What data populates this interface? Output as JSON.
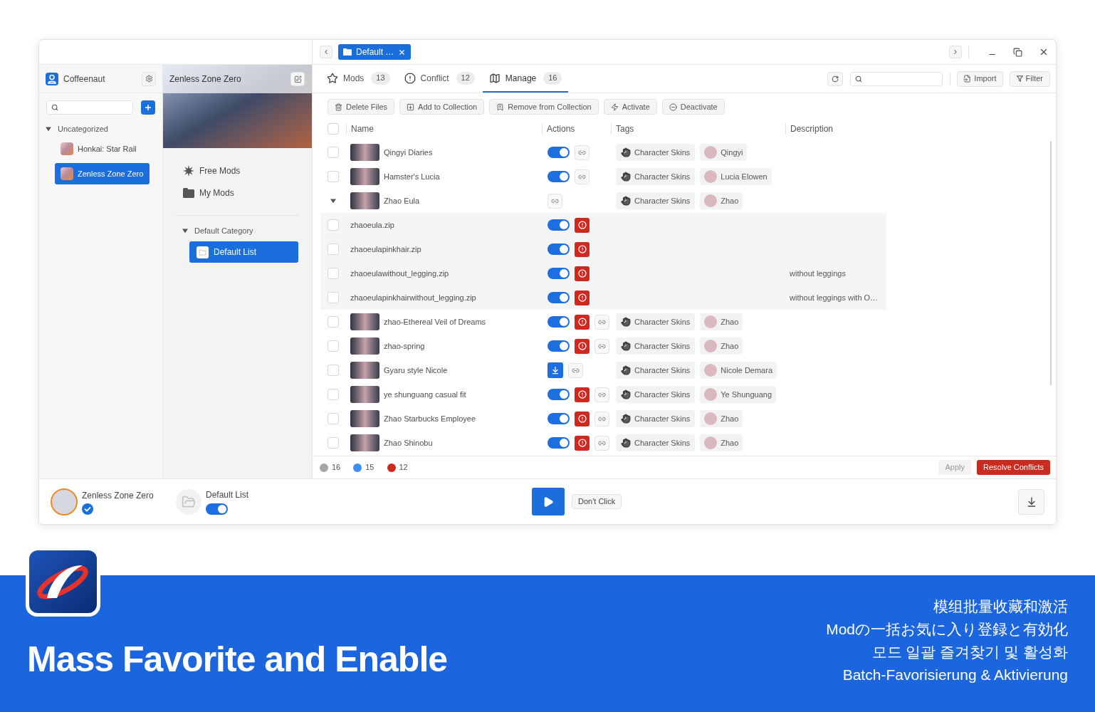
{
  "window": {
    "tab_title": "Default …"
  },
  "sidebar": {
    "app_name": "Coffeenaut",
    "tree": [
      {
        "label": "Uncategorized",
        "expanded": true,
        "children": [
          {
            "label": "Honkai: Star Rail",
            "selected": false
          },
          {
            "label": "Zenless Zone Zero",
            "selected": true
          }
        ]
      }
    ]
  },
  "game_panel": {
    "title": "Zenless Zone Zero",
    "nav": [
      {
        "kind": "free",
        "label": "Free Mods"
      },
      {
        "kind": "folder",
        "label": "My Mods"
      }
    ],
    "categories": [
      {
        "label": "Default Category",
        "expanded": true,
        "children": [
          {
            "label": "Default List",
            "selected": true
          }
        ]
      }
    ]
  },
  "tabs": [
    {
      "label": "Mods",
      "count": "13",
      "selected": false
    },
    {
      "label": "Conflict",
      "count": "12",
      "selected": false
    },
    {
      "label": "Manage",
      "count": "16",
      "selected": true
    }
  ],
  "toolbar": {
    "import_label": "Import",
    "filter_label": "Filter"
  },
  "bulk_actions": [
    "Delete Files",
    "Add to Collection",
    "Remove from Collection",
    "Activate",
    "Deactivate"
  ],
  "table": {
    "header_checked": false,
    "columns": [
      "Name",
      "Actions",
      "Tags",
      "Description"
    ],
    "rows": [
      {
        "kind": "mod",
        "name": "Qingyi Diaries",
        "checked": false,
        "actions": [
          {
            "kind": "toggle",
            "on": true
          },
          {
            "kind": "link"
          }
        ],
        "tags": [
          {
            "kind": "category",
            "label": "Character Skins"
          },
          {
            "kind": "character",
            "label": "Qingyi"
          }
        ]
      },
      {
        "kind": "mod",
        "name": "Hamster's Lucia",
        "checked": false,
        "actions": [
          {
            "kind": "toggle",
            "on": true
          },
          {
            "kind": "link"
          }
        ],
        "tags": [
          {
            "kind": "category",
            "label": "Character Skins"
          },
          {
            "kind": "character",
            "label": "Lucia Elowen"
          }
        ]
      },
      {
        "kind": "mod",
        "name": "Zhao Eula",
        "expanded": true,
        "actions": [
          {
            "kind": "link"
          }
        ],
        "tags": [
          {
            "kind": "category",
            "label": "Character Skins"
          },
          {
            "kind": "character",
            "label": "Zhao"
          }
        ],
        "children": [
          {
            "kind": "file",
            "name": "zhaoeula.zip",
            "checked": false,
            "actions": [
              {
                "kind": "toggle",
                "on": true
              },
              {
                "kind": "conflict"
              }
            ]
          },
          {
            "kind": "file",
            "name": "zhaoeulapinkhair.zip",
            "checked": false,
            "actions": [
              {
                "kind": "toggle",
                "on": true
              },
              {
                "kind": "conflict"
              }
            ]
          },
          {
            "kind": "file",
            "name": "zhaoeulawithout_legging.zip",
            "checked": false,
            "actions": [
              {
                "kind": "toggle",
                "on": true
              },
              {
                "kind": "conflict"
              }
            ],
            "description": "without leggings"
          },
          {
            "kind": "file",
            "name": "zhaoeulapinkhairwithout_legging.zip",
            "checked": false,
            "actions": [
              {
                "kind": "toggle",
                "on": true
              },
              {
                "kind": "conflict"
              }
            ],
            "description": "without leggings with O…"
          }
        ]
      },
      {
        "kind": "mod",
        "name": "zhao-Ethereal Veil of Dreams",
        "checked": false,
        "actions": [
          {
            "kind": "toggle",
            "on": true
          },
          {
            "kind": "conflict"
          },
          {
            "kind": "link"
          }
        ],
        "tags": [
          {
            "kind": "category",
            "label": "Character Skins"
          },
          {
            "kind": "character",
            "label": "Zhao"
          }
        ]
      },
      {
        "kind": "mod",
        "name": "zhao-spring",
        "checked": false,
        "actions": [
          {
            "kind": "toggle",
            "on": true
          },
          {
            "kind": "conflict"
          },
          {
            "kind": "link"
          }
        ],
        "tags": [
          {
            "kind": "category",
            "label": "Character Skins"
          },
          {
            "kind": "character",
            "label": "Zhao"
          }
        ]
      },
      {
        "kind": "mod",
        "name": "Gyaru style Nicole",
        "checked": false,
        "actions": [
          {
            "kind": "download"
          },
          {
            "kind": "link"
          }
        ],
        "tags": [
          {
            "kind": "category",
            "label": "Character Skins"
          },
          {
            "kind": "character",
            "label": "Nicole Demara"
          }
        ]
      },
      {
        "kind": "mod",
        "name": "ye shunguang casual fit",
        "checked": false,
        "actions": [
          {
            "kind": "toggle",
            "on": true
          },
          {
            "kind": "conflict"
          },
          {
            "kind": "link"
          }
        ],
        "tags": [
          {
            "kind": "category",
            "label": "Character Skins"
          },
          {
            "kind": "character",
            "label": "Ye Shunguang"
          }
        ]
      },
      {
        "kind": "mod",
        "name": "Zhao Starbucks Employee",
        "checked": false,
        "actions": [
          {
            "kind": "toggle",
            "on": true
          },
          {
            "kind": "conflict"
          },
          {
            "kind": "link"
          }
        ],
        "tags": [
          {
            "kind": "category",
            "label": "Character Skins"
          },
          {
            "kind": "character",
            "label": "Zhao"
          }
        ]
      },
      {
        "kind": "mod",
        "name": "Zhao Shinobu",
        "checked": false,
        "actions": [
          {
            "kind": "toggle",
            "on": true
          },
          {
            "kind": "conflict"
          },
          {
            "kind": "link"
          }
        ],
        "tags": [
          {
            "kind": "category",
            "label": "Character Skins"
          },
          {
            "kind": "character",
            "label": "Zhao"
          }
        ]
      }
    ]
  },
  "status_bar": {
    "counts": [
      {
        "color": "#a6a6a6",
        "count": "16"
      },
      {
        "color": "#3d8ef0",
        "count": "15"
      },
      {
        "color": "#d0281e",
        "count": "12"
      }
    ],
    "buttons": [
      {
        "label": "Apply",
        "disabled": true
      },
      {
        "label": "Resolve Conflicts",
        "disabled": false
      }
    ]
  },
  "bottom_bar": {
    "game_name": "Zenless Zone Zero",
    "list_name": "Default List",
    "list_on": true,
    "secondary_button": "Don't Click"
  },
  "banner": {
    "title": "Mass Favorite and Enable",
    "taglines": [
      "模组批量收藏和激活",
      "Modの一括お気に入り登録と有効化",
      "모드 일괄 즐겨찾기 및 활성화",
      "Batch-Favorisierung & Aktivierung"
    ]
  }
}
